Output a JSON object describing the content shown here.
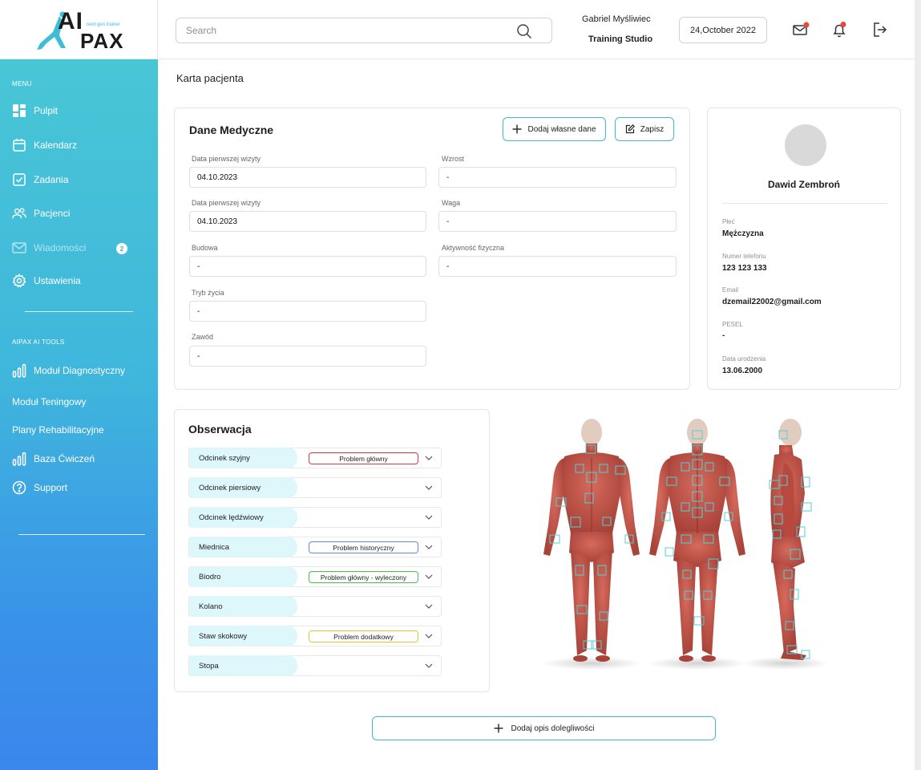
{
  "brand": {
    "name_top": "AI",
    "name_bottom": "PAX",
    "tagline": "next gen trainer"
  },
  "sidebar": {
    "menu_heading": "MENU",
    "items": [
      {
        "label": "Pulpit",
        "icon": "dashboard-icon"
      },
      {
        "label": "Kalendarz",
        "icon": "calendar-icon"
      },
      {
        "label": "Zadania",
        "icon": "checkbox-icon"
      },
      {
        "label": "Pacjenci",
        "icon": "users-icon"
      },
      {
        "label": "Wiadomości",
        "icon": "mail-icon",
        "badge": "2"
      },
      {
        "label": "Ustawienia",
        "icon": "gear-icon"
      }
    ],
    "tools_heading": "AIPAX AI TOOLS",
    "tools": [
      {
        "label": "Moduł Diagnostyczny",
        "icon": "bar-chart-icon"
      },
      {
        "label": "Moduł Teningowy"
      },
      {
        "label": "Plany Rehabilitacyjne"
      },
      {
        "label": "Baza Ćwiczeń",
        "icon": "bar-chart-icon"
      },
      {
        "label": "Support",
        "icon": "help-icon"
      }
    ]
  },
  "header": {
    "search_placeholder": "Search",
    "user_name": "Gabriel Myśliwiec",
    "studio": "Training Studio",
    "date": "24,October 2022"
  },
  "page": {
    "title": "Karta pacjenta"
  },
  "medical": {
    "title": "Dane Medyczne",
    "add_button": "Dodaj własne dane",
    "save_button": "Zapisz",
    "fields": {
      "first_visit_1": {
        "label": "Data pierwszej wizyty",
        "value": "04.10.2023"
      },
      "first_visit_2": {
        "label": "Data pierwszej wizyty",
        "value": "04.10.2023"
      },
      "build": {
        "label": "Budowa",
        "value": "-"
      },
      "lifestyle": {
        "label": "Tryb życia",
        "value": "-"
      },
      "occupation": {
        "label": "Zawód",
        "value": "-"
      },
      "height": {
        "label": "Wzrost",
        "value": "-"
      },
      "weight": {
        "label": "Waga",
        "value": "-"
      },
      "activity": {
        "label": "Aktywność fizyczna",
        "value": "-"
      }
    }
  },
  "profile": {
    "name": "Dawid Zembroń",
    "gender_label": "Płeć",
    "gender": "Mężczyzna",
    "phone_label": "Numer telefonu",
    "phone": "123 123 133",
    "email_label": "Email",
    "email": "dzemail22002@gmail.com",
    "pesel_label": "PESEL",
    "pesel": "-",
    "dob_label": "Data urodzenia",
    "dob": "13.06.2000"
  },
  "observation": {
    "title": "Obserwacja",
    "rows": [
      {
        "label": "Odcinek szyjny",
        "tag": "Problem główny",
        "tag_color": "#d63a3a"
      },
      {
        "label": "Odcinek piersiowy",
        "tag": ""
      },
      {
        "label": "Odcinek lędźwiowy",
        "tag": ""
      },
      {
        "label": "Miednica",
        "tag": "Problem historyczny",
        "tag_color": "#5a8ee0"
      },
      {
        "label": "Biodro",
        "tag": "Problem główny - wyleczony",
        "tag_color": "#49c24a"
      },
      {
        "label": "Kolano",
        "tag": ""
      },
      {
        "label": "Staw skokowy",
        "tag": "Problem dodatkowy",
        "tag_color": "#e2c33a"
      },
      {
        "label": "Stopa",
        "tag": ""
      }
    ]
  },
  "add_description_button": "Dodaj opis dolegliwości",
  "colors": {
    "accent": "#3fbcd2",
    "sidebar_top": "#49c6d6",
    "sidebar_bottom": "#3a86ec",
    "alert_dot": "#e8473c",
    "muscle": "#c7574c"
  }
}
